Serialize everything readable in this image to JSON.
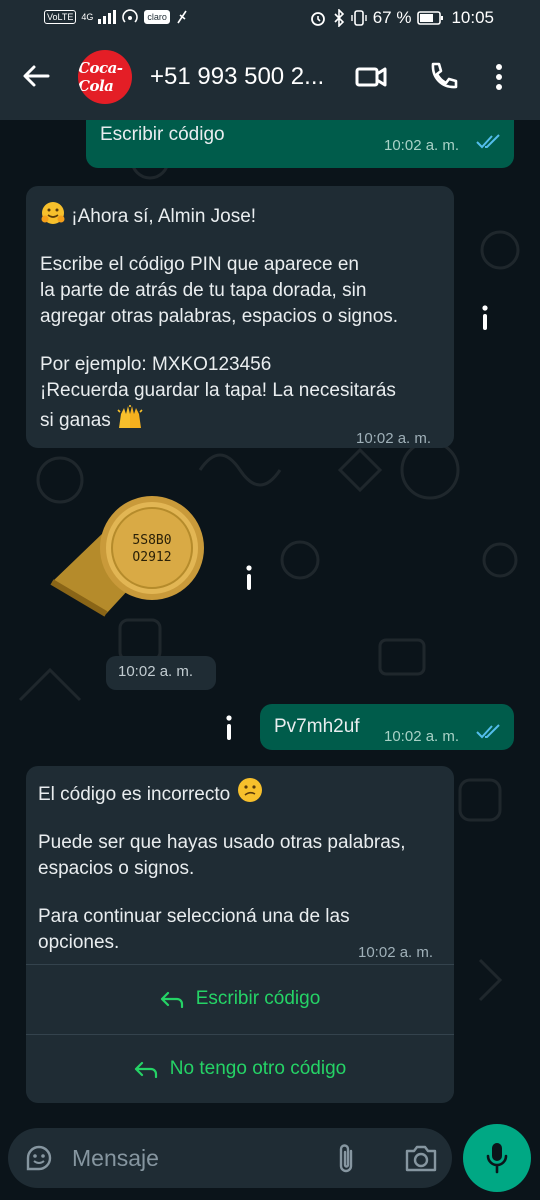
{
  "status_bar": {
    "left_items": [
      "VoLTE",
      "4G",
      "claro"
    ],
    "battery": "67 %",
    "time": "10:05"
  },
  "header": {
    "avatar_text": "Coca-Cola",
    "contact": "+51 993 500 2..."
  },
  "messages": {
    "top_sent": {
      "text": "Escribir código",
      "time": "10:02 a. m."
    },
    "intro": {
      "greeting": "¡Ahora sí, Almin Jose!",
      "line1": "Escribe el código PIN que aparece en",
      "line2": "la parte de atrás de tu tapa dorada, sin",
      "line3": "agregar otras palabras, espacios o signos.",
      "line4": "Por ejemplo: MXKO123456",
      "line5": "¡Recuerda guardar la tapa! La necesitarás",
      "line6": "si ganas",
      "time": "10:02 a. m."
    },
    "cap": {
      "code_line1": "5S8B0",
      "code_line2": "O2912",
      "time": "10:02 a. m."
    },
    "sent_code": {
      "text": "Pv7mh2uf",
      "time": "10:02 a. m."
    },
    "error": {
      "line1": "El código es incorrecto",
      "line2": "Puede ser que hayas usado otras palabras,",
      "line3": "espacios o signos.",
      "line4": "Para continuar seleccioná una de las",
      "line5": "opciones.",
      "time": "10:02 a. m.",
      "action1": "Escribir código",
      "action2": "No tengo otro código"
    }
  },
  "input": {
    "placeholder": "Mensaje"
  },
  "colors": {
    "accent": "#25d366",
    "outgoing": "#005c4b",
    "incoming": "#1f2c34",
    "background": "#0b141a",
    "brand": "#e41e26"
  }
}
